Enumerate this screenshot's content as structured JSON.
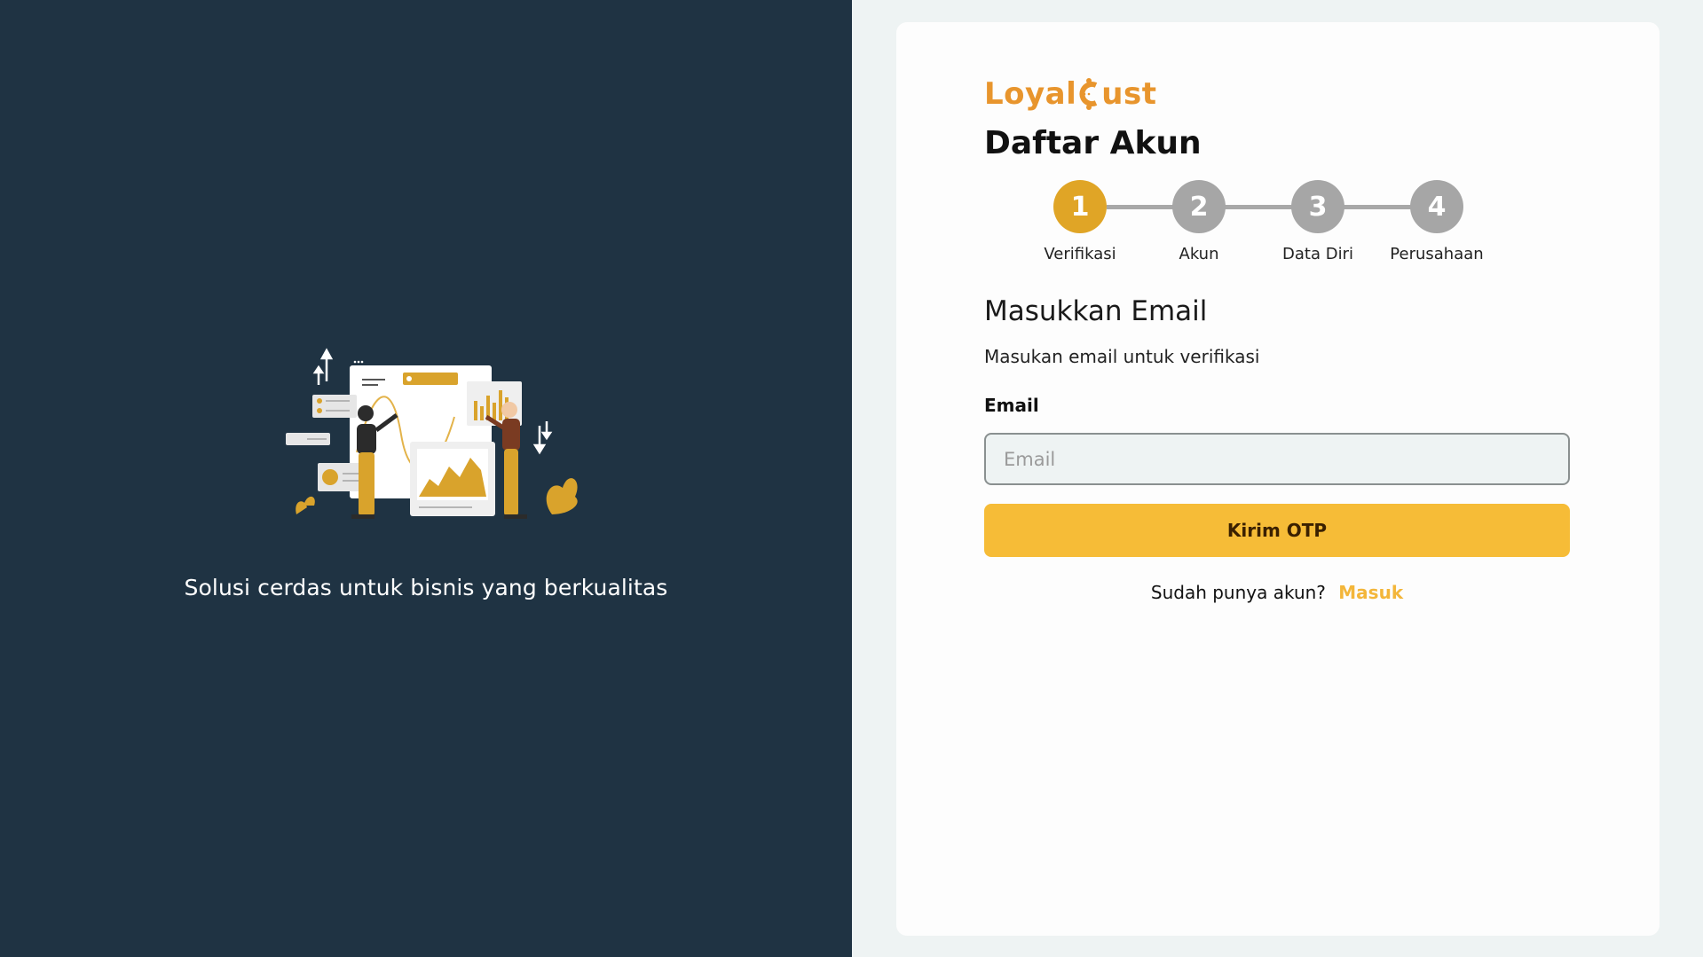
{
  "left": {
    "tagline": "Solusi cerdas untuk bisnis yang berkualitas"
  },
  "brand": {
    "logo_text_pre": "Loyal",
    "logo_text_post": "ust",
    "logo_color": "#e8952d"
  },
  "form": {
    "title": "Daftar Akun",
    "steps": [
      {
        "number": "1",
        "label": "Verifikasi",
        "active": true
      },
      {
        "number": "2",
        "label": "Akun",
        "active": false
      },
      {
        "number": "3",
        "label": "Data Diri",
        "active": false
      },
      {
        "number": "4",
        "label": "Perusahaan",
        "active": false
      }
    ],
    "section_title": "Masukkan Email",
    "section_subtitle": "Masukan email untuk verifikasi",
    "email_label": "Email",
    "email_placeholder": "Email",
    "email_value": "",
    "submit_label": "Kirim OTP",
    "login_prompt": "Sudah punya akun?",
    "login_link": "Masuk"
  },
  "colors": {
    "left_bg": "#1f3343",
    "accent": "#f6bc37",
    "step_active": "#e0a526",
    "step_inactive": "#a6a6a6",
    "link": "#f3b63a"
  }
}
